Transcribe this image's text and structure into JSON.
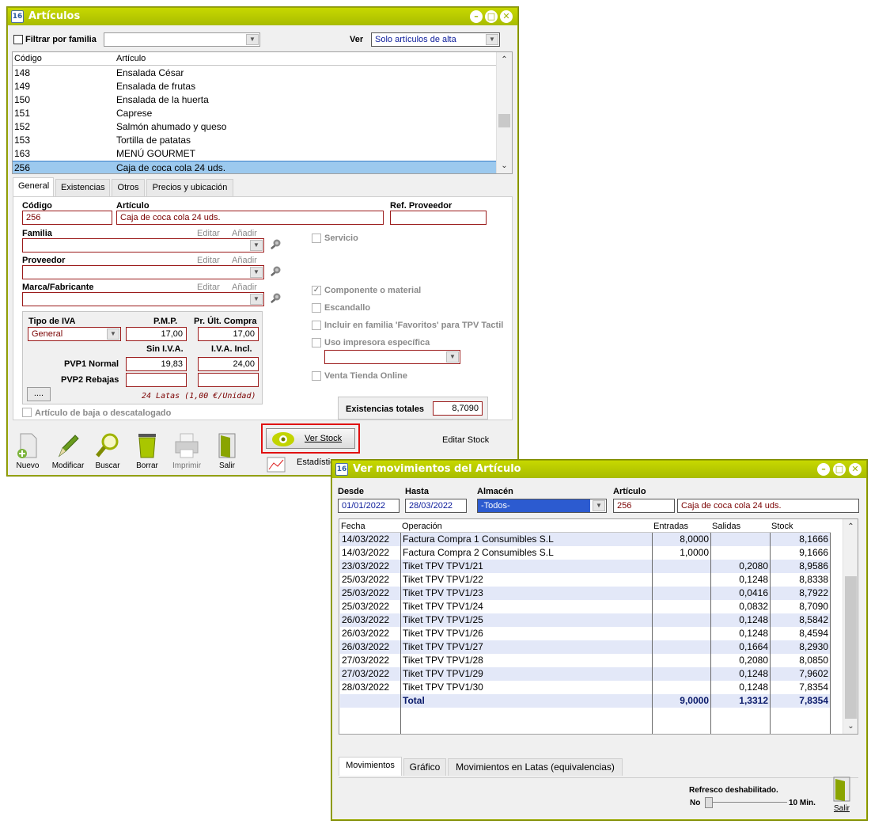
{
  "articulos": {
    "title": "Artículos",
    "filtrar_label": "Filtrar por familia",
    "ver_label": "Ver",
    "ver_value": "Solo artículos de alta",
    "list": {
      "col_codigo": "Código",
      "col_articulo": "Artículo",
      "rows": [
        {
          "codigo": "148",
          "articulo": "Ensalada César"
        },
        {
          "codigo": "149",
          "articulo": "Ensalada de frutas"
        },
        {
          "codigo": "150",
          "articulo": "Ensalada de la huerta"
        },
        {
          "codigo": "151",
          "articulo": "Caprese"
        },
        {
          "codigo": "152",
          "articulo": "Salmón ahumado y queso"
        },
        {
          "codigo": "153",
          "articulo": "Tortilla de patatas"
        },
        {
          "codigo": "163",
          "articulo": "MENÚ GOURMET"
        },
        {
          "codigo": "256",
          "articulo": "Caja de coca cola 24 uds."
        }
      ]
    },
    "tabs": [
      "General",
      "Existencias",
      "Otros",
      "Precios y ubicación"
    ],
    "form": {
      "codigo_label": "Código",
      "codigo_value": "256",
      "articulo_label": "Artículo",
      "articulo_value": "Caja de coca cola 24 uds.",
      "refprov_label": "Ref. Proveedor",
      "familia_label": "Familia",
      "proveedor_label": "Proveedor",
      "marca_label": "Marca/Fabricante",
      "editar": "Editar",
      "anadir": "Añadir",
      "servicio": "Servicio",
      "componente": "Componente o material",
      "escandallo": "Escandallo",
      "favoritos": "Incluir en familia 'Favoritos' para TPV Tactil",
      "impresora": "Uso impresora específica",
      "venta_online": "Venta Tienda Online",
      "tipo_iva_label": "Tipo de IVA",
      "tipo_iva_value": "General",
      "pmp_label": "P.M.P.",
      "pmp_value": "17,00",
      "ult_compra_label": "Pr. Últ. Compra",
      "ult_compra_value": "17,00",
      "sin_iva_label": "Sin I.V.A.",
      "iva_incl_label": "I.V.A. Incl.",
      "pvp1_label": "PVP1 Normal",
      "pvp1_sin": "19,83",
      "pvp1_con": "24,00",
      "pvp2_label": "PVP2 Rebajas",
      "dots": "....",
      "latas_note": "24 Latas (1,00 €/Unidad)",
      "baja_label": "Artículo de baja o descatalogado",
      "existencias_label": "Existencias totales",
      "existencias_value": "8,7090"
    },
    "toolbar": {
      "nuevo": "Nuevo",
      "modificar": "Modificar",
      "buscar": "Buscar",
      "borrar": "Borrar",
      "imprimir": "Imprimir",
      "salir": "Salir",
      "ver_stock": "Ver Stock",
      "editar_stock": "Editar Stock",
      "estadisticas": "Estadístic"
    }
  },
  "movimientos": {
    "title": "Ver movimientos del Artículo",
    "desde_label": "Desde",
    "desde_value": "01/01/2022",
    "hasta_label": "Hasta",
    "hasta_value": "28/03/2022",
    "almacen_label": "Almacén",
    "almacen_value": "-Todos-",
    "articulo_label": "Artículo",
    "articulo_code": "256",
    "articulo_name": "Caja de coca cola 24 uds.",
    "headers": {
      "fecha": "Fecha",
      "operacion": "Operación",
      "entradas": "Entradas",
      "salidas": "Salidas",
      "stock": "Stock"
    },
    "rows": [
      {
        "fecha": "14/03/2022",
        "operacion": "Factura Compra 1 Consumibles S.L",
        "entradas": "8,0000",
        "salidas": "",
        "stock": "8,1666"
      },
      {
        "fecha": "14/03/2022",
        "operacion": "Factura Compra 2 Consumibles S.L",
        "entradas": "1,0000",
        "salidas": "",
        "stock": "9,1666"
      },
      {
        "fecha": "23/03/2022",
        "operacion": "Tiket TPV TPV1/21",
        "entradas": "",
        "salidas": "0,2080",
        "stock": "8,9586"
      },
      {
        "fecha": "25/03/2022",
        "operacion": "Tiket TPV TPV1/22",
        "entradas": "",
        "salidas": "0,1248",
        "stock": "8,8338"
      },
      {
        "fecha": "25/03/2022",
        "operacion": "Tiket TPV TPV1/23",
        "entradas": "",
        "salidas": "0,0416",
        "stock": "8,7922"
      },
      {
        "fecha": "25/03/2022",
        "operacion": "Tiket TPV TPV1/24",
        "entradas": "",
        "salidas": "0,0832",
        "stock": "8,7090"
      },
      {
        "fecha": "26/03/2022",
        "operacion": "Tiket TPV TPV1/25",
        "entradas": "",
        "salidas": "0,1248",
        "stock": "8,5842"
      },
      {
        "fecha": "26/03/2022",
        "operacion": "Tiket TPV TPV1/26",
        "entradas": "",
        "salidas": "0,1248",
        "stock": "8,4594"
      },
      {
        "fecha": "26/03/2022",
        "operacion": "Tiket TPV TPV1/27",
        "entradas": "",
        "salidas": "0,1664",
        "stock": "8,2930"
      },
      {
        "fecha": "27/03/2022",
        "operacion": "Tiket TPV TPV1/28",
        "entradas": "",
        "salidas": "0,2080",
        "stock": "8,0850"
      },
      {
        "fecha": "27/03/2022",
        "operacion": "Tiket TPV TPV1/29",
        "entradas": "",
        "salidas": "0,1248",
        "stock": "7,9602"
      },
      {
        "fecha": "28/03/2022",
        "operacion": "Tiket TPV TPV1/30",
        "entradas": "",
        "salidas": "0,1248",
        "stock": "7,8354"
      }
    ],
    "total": {
      "label": "Total",
      "entradas": "9,0000",
      "salidas": "1,3312",
      "stock": "7,8354"
    },
    "tabs": [
      "Movimientos",
      "Gráfico",
      "Movimientos en Latas (equivalencias)"
    ],
    "refresco_label": "Refresco deshabilitado.",
    "refresco_no": "No",
    "refresco_max": "10 Min.",
    "salir": "Salir"
  }
}
